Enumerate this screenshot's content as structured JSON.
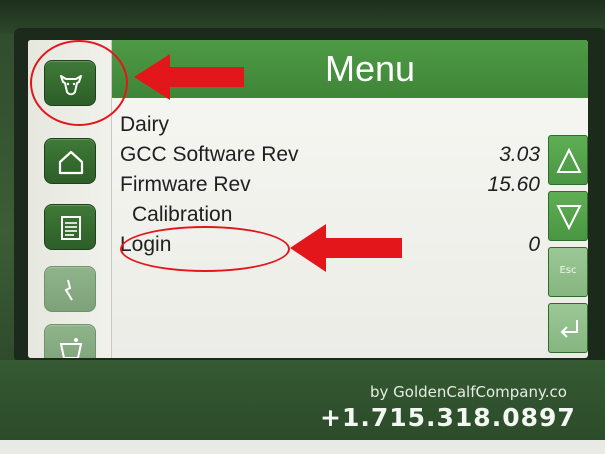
{
  "screen": {
    "title": "Menu",
    "sidebar": [
      {
        "icon": "cow-head-icon"
      },
      {
        "icon": "home-icon"
      },
      {
        "icon": "document-icon"
      },
      {
        "icon": "wrench-icon"
      },
      {
        "icon": "feeder-icon"
      }
    ],
    "items": [
      {
        "label": "Dairy",
        "value": ""
      },
      {
        "label": "GCC Software Rev",
        "value": "3.03"
      },
      {
        "label": "Firmware Rev",
        "value": "15.60"
      },
      {
        "label": "Calibration",
        "value": ""
      },
      {
        "label": "Login",
        "value": "0"
      }
    ],
    "nav": {
      "up": "up-arrow-icon",
      "down": "down-arrow-icon",
      "esc_label": "Esc",
      "enter": "enter-icon"
    }
  },
  "footer": {
    "url": "by GoldenCalfCompany.co",
    "phone": "+1.715.318.0897"
  },
  "colors": {
    "header_green": "#4e9a45",
    "annotation_red": "#e3161c"
  }
}
